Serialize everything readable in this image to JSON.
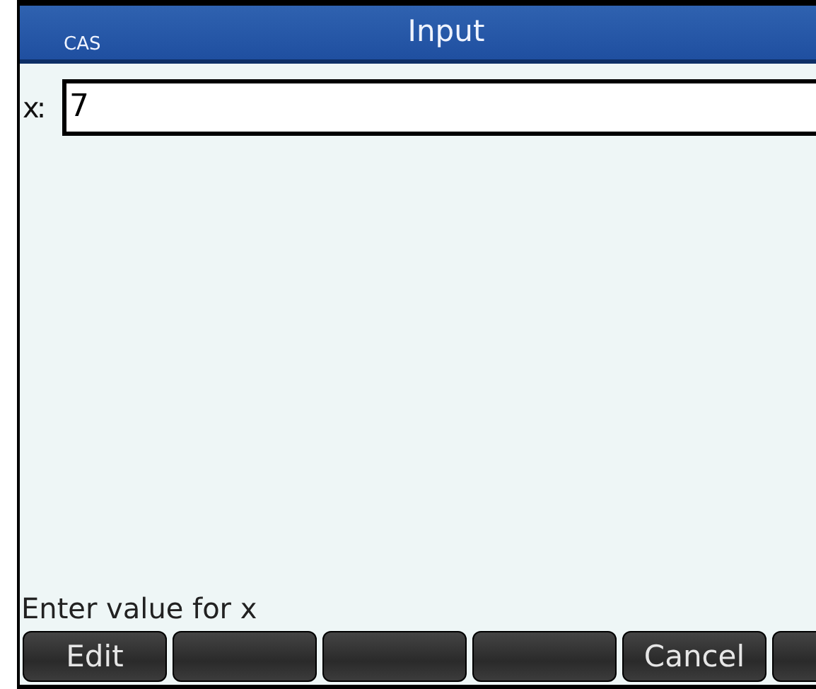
{
  "header": {
    "mode": "CAS",
    "title": "Input"
  },
  "field": {
    "label": "x:",
    "value": "7"
  },
  "help_text": "Enter value for x",
  "softkeys": [
    {
      "kind": "labelled",
      "label": "Edit"
    },
    {
      "kind": "blank"
    },
    {
      "kind": "blank"
    },
    {
      "kind": "blank"
    },
    {
      "kind": "labelled",
      "label": "Cancel"
    },
    {
      "kind": "blank"
    }
  ]
}
